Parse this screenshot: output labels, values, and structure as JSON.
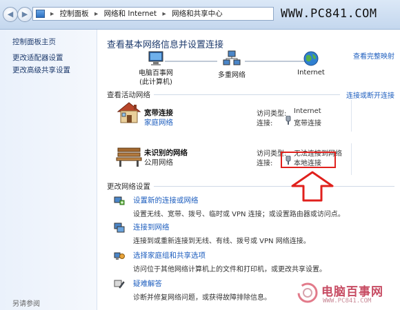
{
  "breadcrumb": [
    "控制面板",
    "网络和 Internet",
    "网络和共享中心"
  ],
  "watermark": "WWW.PC841.COM",
  "sidebar": {
    "items": [
      {
        "label": "控制面板主页"
      },
      {
        "label": "更改适配器设置"
      },
      {
        "label": "更改高级共享设置"
      }
    ],
    "see_also": "另请参阅"
  },
  "main": {
    "title": "查看基本网络信息并设置连接",
    "full_map": "查看完整映射",
    "map": {
      "computer": "电脑百事网\n(此计算机)",
      "network": "多重网络",
      "internet": "Internet"
    },
    "active_header": "查看活动网络",
    "connect_disconnect": "连接或断开连接",
    "networks": [
      {
        "name": "宽带连接",
        "type": "家庭网络",
        "access_label": "访问类型:",
        "access_value": "Internet",
        "conn_label": "连接:",
        "conn_value": "宽带连接"
      },
      {
        "name": "未识别的网络",
        "type": "公用网络",
        "access_label": "访问类型:",
        "access_value": "无法连接到网络",
        "conn_label": "连接:",
        "conn_value": "本地连接"
      }
    ],
    "change_header": "更改网络设置",
    "tasks": [
      {
        "title": "设置新的连接或网络",
        "desc": "设置无线、宽带、拨号、临时或 VPN 连接；或设置路由器或访问点。"
      },
      {
        "title": "连接到网络",
        "desc": "连接到或重新连接到无线、有线、拨号或 VPN 网络连接。"
      },
      {
        "title": "选择家庭组和共享选项",
        "desc": "访问位于其他网络计算机上的文件和打印机，或更改共享设置。"
      },
      {
        "title": "疑难解答",
        "desc": "诊断并修复网络问题，或获得故障排除信息。"
      }
    ]
  },
  "logo": {
    "brand": "电脑百事网",
    "url": "WWW.PC841.COM"
  },
  "colors": {
    "link": "#1f5fbf",
    "highlight": "#e0201c"
  }
}
